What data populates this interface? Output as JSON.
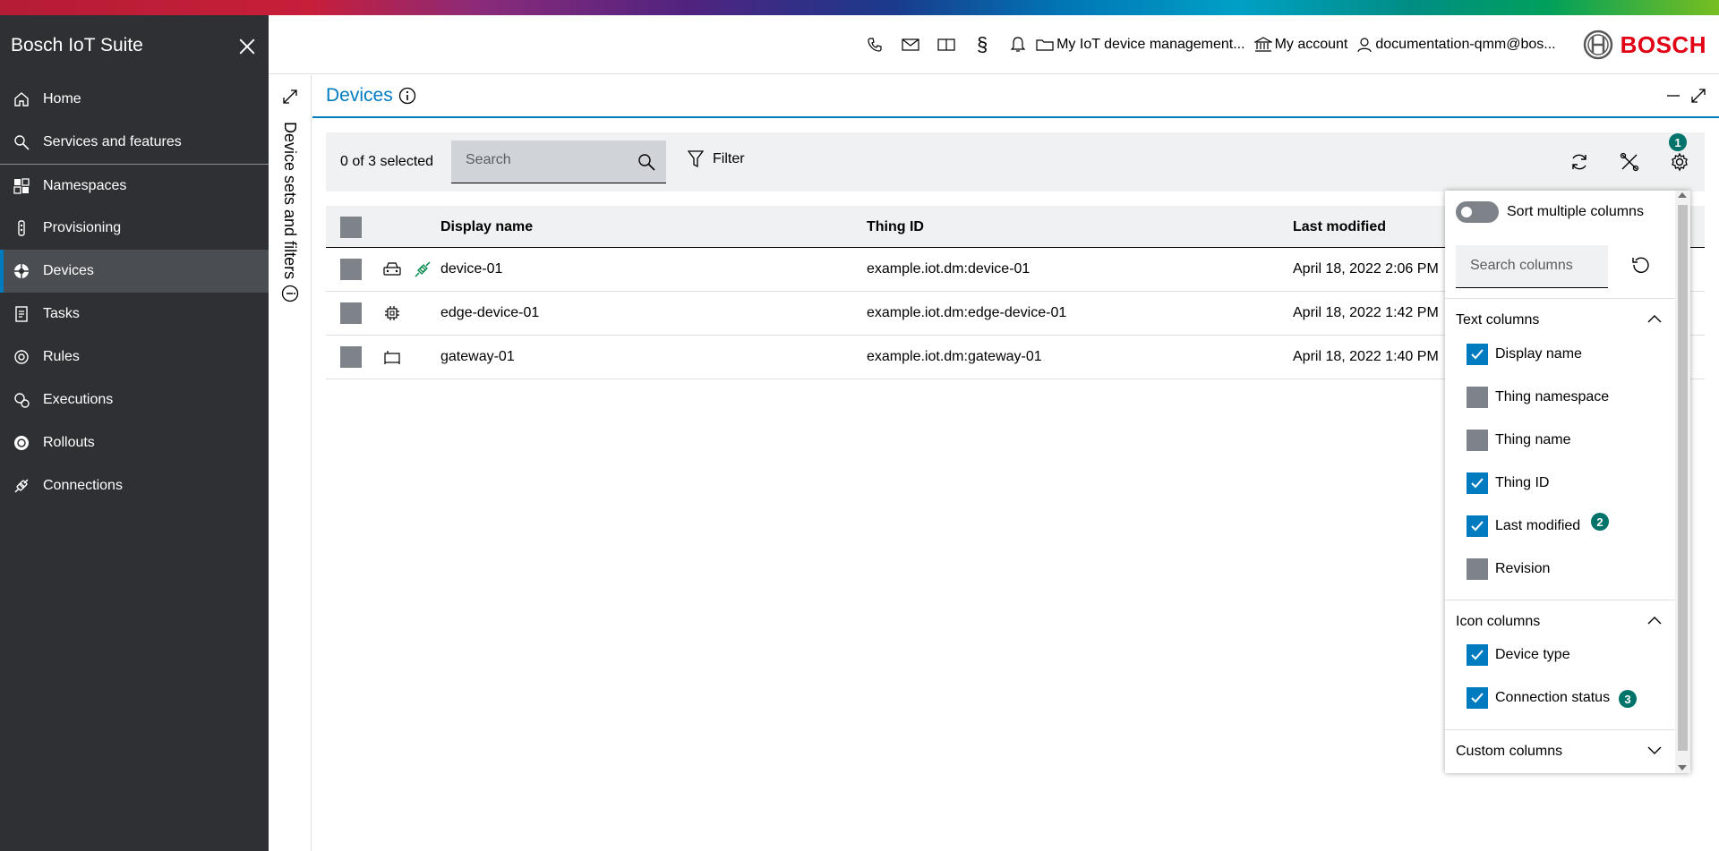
{
  "sidebar": {
    "title": "Bosch IoT Suite",
    "items": [
      {
        "label": "Home",
        "icon": "home-icon"
      },
      {
        "label": "Services and features",
        "icon": "search-icon"
      },
      {
        "label": "Namespaces",
        "icon": "namespaces-icon"
      },
      {
        "label": "Provisioning",
        "icon": "provisioning-icon"
      },
      {
        "label": "Devices",
        "icon": "devices-icon",
        "active": true
      },
      {
        "label": "Tasks",
        "icon": "tasks-icon"
      },
      {
        "label": "Rules",
        "icon": "rules-icon"
      },
      {
        "label": "Executions",
        "icon": "executions-icon"
      },
      {
        "label": "Rollouts",
        "icon": "rollouts-icon"
      },
      {
        "label": "Connections",
        "icon": "connections-icon"
      }
    ]
  },
  "header": {
    "subscription_label": "My IoT device management...",
    "account_label": "My account",
    "user_label": "documentation-qmm@bos...",
    "brand": "BOSCH",
    "icons": [
      "phone-icon",
      "mail-icon",
      "book-icon",
      "paragraph-icon",
      "bell-icon"
    ],
    "paragraph_glyph": "§"
  },
  "side_panel": {
    "label": "Device sets and filters"
  },
  "main": {
    "title": "Devices",
    "selected_count": "0 of 3 selected",
    "search_placeholder": "Search",
    "filter_label": "Filter",
    "badge_settings": "1"
  },
  "table": {
    "headers": {
      "display_name": "Display name",
      "thing_id": "Thing ID",
      "last_modified": "Last modified"
    },
    "rows": [
      {
        "display_name": "device-01",
        "thing_id": "example.iot.dm:device-01",
        "last_modified": "April 18, 2022 2:06 PM",
        "device_type_icon": "device-icon",
        "connected": true
      },
      {
        "display_name": "edge-device-01",
        "thing_id": "example.iot.dm:edge-device-01",
        "last_modified": "April 18, 2022 1:42 PM",
        "device_type_icon": "chip-icon",
        "connected": false
      },
      {
        "display_name": "gateway-01",
        "thing_id": "example.iot.dm:gateway-01",
        "last_modified": "April 18, 2022 1:40 PM",
        "device_type_icon": "gateway-icon",
        "connected": false
      }
    ]
  },
  "column_settings": {
    "sort_multiple_label": "Sort multiple columns",
    "search_placeholder": "Search columns",
    "text_columns_label": "Text columns",
    "text_columns": [
      {
        "label": "Display name",
        "checked": true
      },
      {
        "label": "Thing namespace",
        "checked": false
      },
      {
        "label": "Thing name",
        "checked": false
      },
      {
        "label": "Thing ID",
        "checked": true
      },
      {
        "label": "Last modified",
        "checked": true
      },
      {
        "label": "Revision",
        "checked": false
      }
    ],
    "icon_columns_label": "Icon columns",
    "icon_columns": [
      {
        "label": "Device type",
        "checked": true
      },
      {
        "label": "Connection status",
        "checked": true
      }
    ],
    "custom_columns_label": "Custom columns",
    "badge_last_modified": "2",
    "badge_connection_status": "3"
  },
  "colors": {
    "accent": "#007bc0",
    "sidebar_bg": "#2e3033",
    "badge": "#00736a",
    "connected": "#00884a",
    "brand_red": "#e20015"
  }
}
